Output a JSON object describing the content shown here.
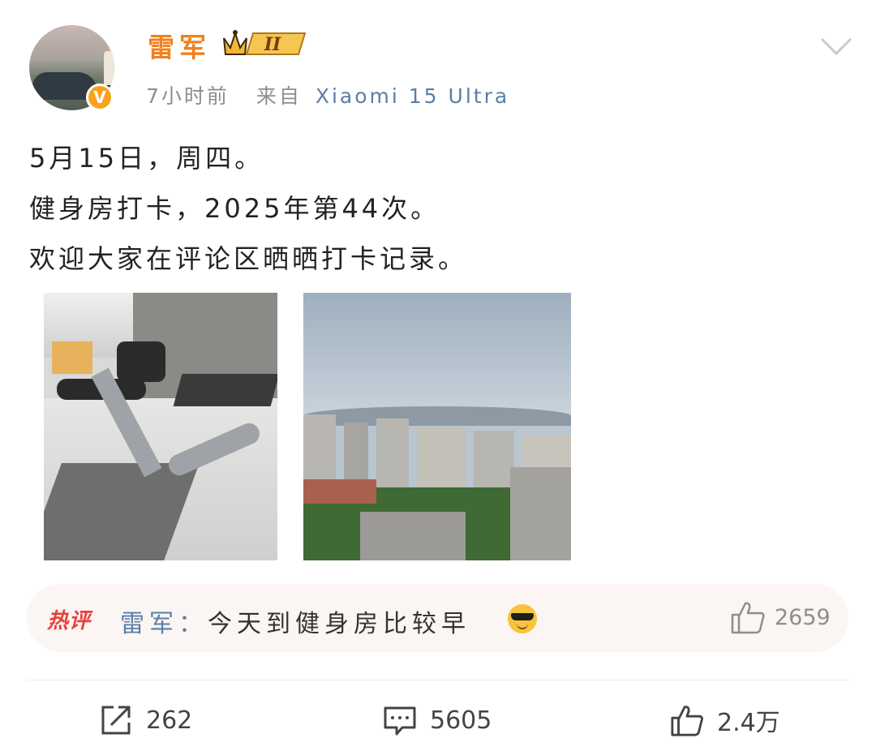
{
  "author": {
    "name": "雷军",
    "vip_level": "II",
    "verified_badge": "V",
    "avatar_icon": "avatar"
  },
  "post_meta": {
    "time": "7小时前",
    "from_label": "来自",
    "source": "Xiaomi 15 Ultra"
  },
  "post": {
    "lines": [
      "5月15日，周四。",
      "健身房打卡，2025年第44次。",
      "欢迎大家在评论区晒晒打卡记录。"
    ]
  },
  "images": [
    {
      "icon": "gym-photo"
    },
    {
      "icon": "city-skyline-photo"
    }
  ],
  "hot_comment": {
    "tag": "热评",
    "author": "雷军：",
    "text": "今天到健身房比较早",
    "emoji": "sunglasses-emoji",
    "likes": "2659"
  },
  "actions": {
    "share_count": "262",
    "comment_count": "5605",
    "like_count": "2.4万"
  },
  "colors": {
    "username": "#f2801e",
    "link_blue": "#5a7ea6",
    "hot_red": "#e8403a",
    "badge_orange": "#f8a31b"
  }
}
